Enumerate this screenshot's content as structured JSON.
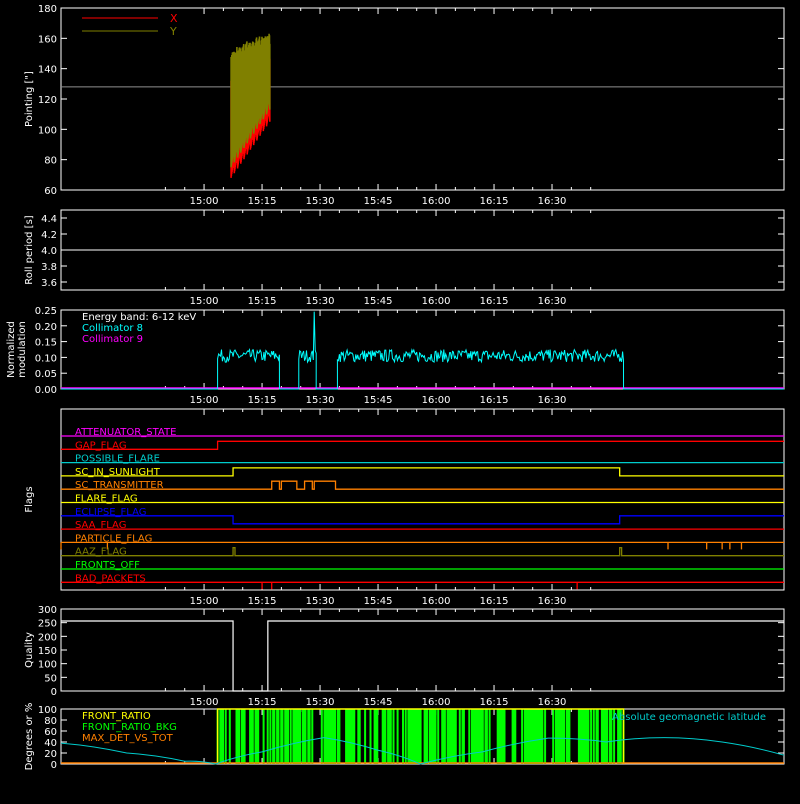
{
  "colors": {
    "background": "#000000",
    "axis": "#ffffff",
    "x_series": "#ff0000",
    "y_series": "#808000",
    "collimator8": "#00ffff",
    "collimator9": "#ff00ff",
    "lat_curve": "#00cccc",
    "front_ratio": "#ffff00",
    "front_ratio_bg": "#00ff00",
    "max_det_vs_tot": "#ff8000"
  },
  "time_ticks": [
    "15:00",
    "15:15",
    "15:30",
    "15:45",
    "16:00",
    "16:15",
    "16:30"
  ],
  "chart_data": [
    {
      "id": "pointing",
      "type": "line",
      "ylabel": "Pointing [\"]",
      "ylim": [
        60,
        180
      ],
      "yticks": [
        "60",
        "80",
        "100",
        "120",
        "140",
        "160",
        "180"
      ],
      "xlim_minutes": [
        -37,
        150
      ],
      "legend": [
        {
          "name": "X",
          "color": "#ff0000"
        },
        {
          "name": "Y",
          "color": "#808000"
        }
      ],
      "reference_line": 128,
      "series": [
        {
          "name": "X",
          "t_start": 7,
          "t_end": 17,
          "min_start": 68,
          "min_end": 105,
          "max_start": 138,
          "max_end": 150
        },
        {
          "name": "Y",
          "t_start": 7,
          "t_end": 17,
          "min_start": 75,
          "min_end": 113,
          "max_start": 150,
          "max_end": 162
        }
      ]
    },
    {
      "id": "roll",
      "type": "line",
      "ylabel": "Roll period [s]",
      "ylim": [
        3.5,
        4.5
      ],
      "yticks": [
        "3.6",
        "3.8",
        "4.0",
        "4.2",
        "4.4"
      ],
      "value": 4.0
    },
    {
      "id": "modulation",
      "type": "line",
      "ylabel": [
        "Normalized",
        "modulation"
      ],
      "ylim": [
        0,
        0.25
      ],
      "yticks": [
        "0.00",
        "0.05",
        "0.10",
        "0.15",
        "0.20",
        "0.25"
      ],
      "legend": [
        {
          "name": "Energy band: 6-12 keV",
          "color": "#ffffff"
        },
        {
          "name": "Collimator 8",
          "color": "#00ffff"
        },
        {
          "name": "Collimator 9",
          "color": "#ff00ff"
        }
      ],
      "segments": [
        {
          "t_start": 3.5,
          "t_end": 19.5,
          "level": 0.105
        },
        {
          "t_start": 24.5,
          "t_end": 29,
          "level": 0.105
        },
        {
          "t_start": 34.5,
          "t_end": 108.5,
          "level": 0.105
        }
      ],
      "spike": {
        "t": 28.5,
        "value": 0.245
      }
    },
    {
      "id": "flags",
      "type": "step",
      "ylabel": "Flags",
      "flags": [
        {
          "name": "ATTENUATOR_STATE",
          "color": "#ff00ff",
          "changes": []
        },
        {
          "name": "GAP_FLAG",
          "color": "#ff0000",
          "changes": [
            [
              3.5,
              1
            ],
            [
              111.5,
              2
            ]
          ]
        },
        {
          "name": "POSSIBLE_FLARE",
          "color": "#00cccc",
          "changes": []
        },
        {
          "name": "SC_IN_SUNLIGHT",
          "color": "#ffff00",
          "changes": [
            [
              7.5,
              1
            ],
            [
              107.5,
              0
            ]
          ]
        },
        {
          "name": "SC_TRANSMITTER",
          "color": "#ff8000",
          "pulses": [
            [
              17.5,
              19.5
            ],
            [
              20,
              24
            ],
            [
              26,
              28
            ],
            [
              28.5,
              34
            ]
          ]
        },
        {
          "name": "FLARE_FLAG",
          "color": "#ffff00",
          "changes": []
        },
        {
          "name": "ECLIPSE_FLAG",
          "color": "#0000ff",
          "changes": [
            [
              7.5,
              -1
            ],
            [
              107.5,
              0
            ]
          ]
        },
        {
          "name": "SAA_FLAG",
          "color": "#ff0000",
          "changes": []
        },
        {
          "name": "PARTICLE_FLAG",
          "color": "#ff8000",
          "spikes": [
            -37,
            -25,
            120,
            130,
            134,
            136,
            139
          ]
        },
        {
          "name": "AAZ_FLAG",
          "color": "#808000",
          "pulses": [
            [
              7.5,
              8
            ],
            [
              107.5,
              108
            ]
          ]
        },
        {
          "name": "FRONTS_OFF",
          "color": "#00ff00",
          "changes": []
        },
        {
          "name": "BAD_PACKETS",
          "color": "#ff0000",
          "spikes": [
            15,
            17.5,
            96.5
          ]
        }
      ]
    },
    {
      "id": "quality",
      "type": "step",
      "ylabel": "Quality",
      "ylim": [
        0,
        300
      ],
      "yticks": [
        "0",
        "50",
        "100",
        "150",
        "200",
        "250",
        "300"
      ],
      "steps": [
        [
          -37,
          256
        ],
        [
          7.5,
          0
        ],
        [
          16.5,
          256
        ],
        [
          150,
          256
        ]
      ]
    },
    {
      "id": "ratios",
      "type": "area",
      "ylabel": "Degrees or %",
      "ylim": [
        0,
        100
      ],
      "yticks": [
        "0",
        "20",
        "40",
        "60",
        "80",
        "100"
      ],
      "legend": [
        {
          "name": "FRONT_RATIO",
          "color": "#ffff00"
        },
        {
          "name": "FRONT_RATIO_BKG",
          "color": "#00ff00"
        },
        {
          "name": "MAX_DET_VS_TOT",
          "color": "#ff8000"
        }
      ],
      "right_label": "Absolute geomagnetic latitude",
      "fill_range": [
        3.5,
        108.5
      ],
      "latitude_points": [
        [
          -37,
          38
        ],
        [
          -20,
          20
        ],
        [
          -5,
          5
        ],
        [
          3,
          0
        ],
        [
          15,
          22
        ],
        [
          31,
          48
        ],
        [
          45,
          25
        ],
        [
          56,
          0
        ],
        [
          72,
          22
        ],
        [
          89,
          47
        ],
        [
          104,
          40
        ],
        [
          119,
          48
        ],
        [
          134,
          40
        ],
        [
          150,
          16
        ]
      ]
    }
  ]
}
